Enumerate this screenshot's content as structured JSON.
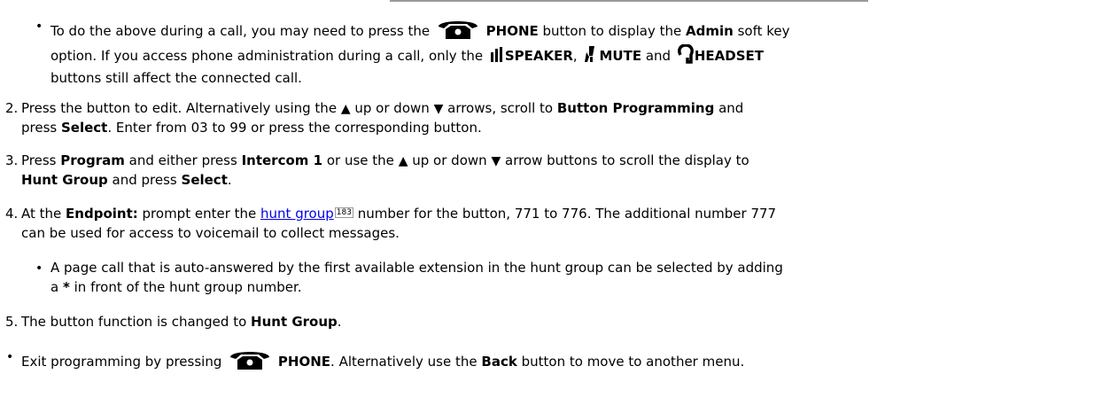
{
  "top_bullet": {
    "l1_a": "To do the above during a call, you may need to press the",
    "l1_phone": "PHONE",
    "l1_b": "button to display the",
    "l1_admin": "Admin",
    "l1_c": "soft key",
    "l2_a": "option. If you access phone administration during a call, only the",
    "l2_speaker": "SPEAKER",
    "l2_comma": ",",
    "l2_mute": "MUTE",
    "l2_and": "and",
    "l2_headset": "HEADSET",
    "l3": "buttons still affect the connected call."
  },
  "step2": {
    "num": "2.",
    "l1_a": "Press the button to edit. Alternatively using the",
    "l1_b": "up or down",
    "l1_c": "arrows, scroll to",
    "l1_bp": "Button Programming",
    "l1_and": "and",
    "l2_a": "press",
    "l2_select": "Select",
    "l2_b": ". Enter from 03 to 99 or press the corresponding button."
  },
  "step3": {
    "num": "3.",
    "l1_a": "Press",
    "l1_program": "Program",
    "l1_b": "and either press",
    "l1_intercom": "Intercom 1",
    "l1_c": "or use the",
    "l1_d": "up or down",
    "l1_e": "arrow buttons to scroll the display to",
    "l2_hg": "Hunt Group",
    "l2_and": "and press",
    "l2_select": "Select",
    "l2_dot": "."
  },
  "step4": {
    "num": "4.",
    "l1_a": "At the",
    "l1_endpoint": "Endpoint:",
    "l1_b": "prompt enter the",
    "l1_link": "hunt group",
    "l1_ref": "183",
    "l1_c": "number for the button, 771 to 776. The additional number 777",
    "l2": "can be used for access to voicemail to collect messages."
  },
  "sub_bullet": {
    "l1": "A page call that is auto-answered by the first available extension in the hunt group can be selected by adding",
    "l2_a": "a",
    "l2_star": "*",
    "l2_b": "in front of the hunt group number."
  },
  "step5": {
    "num": "5.",
    "a": "The button function is changed to",
    "hg": "Hunt Group",
    "dot": "."
  },
  "bottom_bullet": {
    "a": "Exit programming by pressing",
    "phone": "PHONE",
    "b": ". Alternatively use the",
    "back": "Back",
    "c": "button to move to another menu."
  },
  "glyphs": {
    "bullet": "•",
    "up": "▲",
    "down": "▼"
  },
  "colors": {
    "link": "#0000ee",
    "text": "#000000",
    "rule": "#9a9a9a"
  },
  "icons": [
    "phone-icon",
    "speaker-icon",
    "mute-icon",
    "headset-icon",
    "up-arrow-icon",
    "down-arrow-icon"
  ]
}
